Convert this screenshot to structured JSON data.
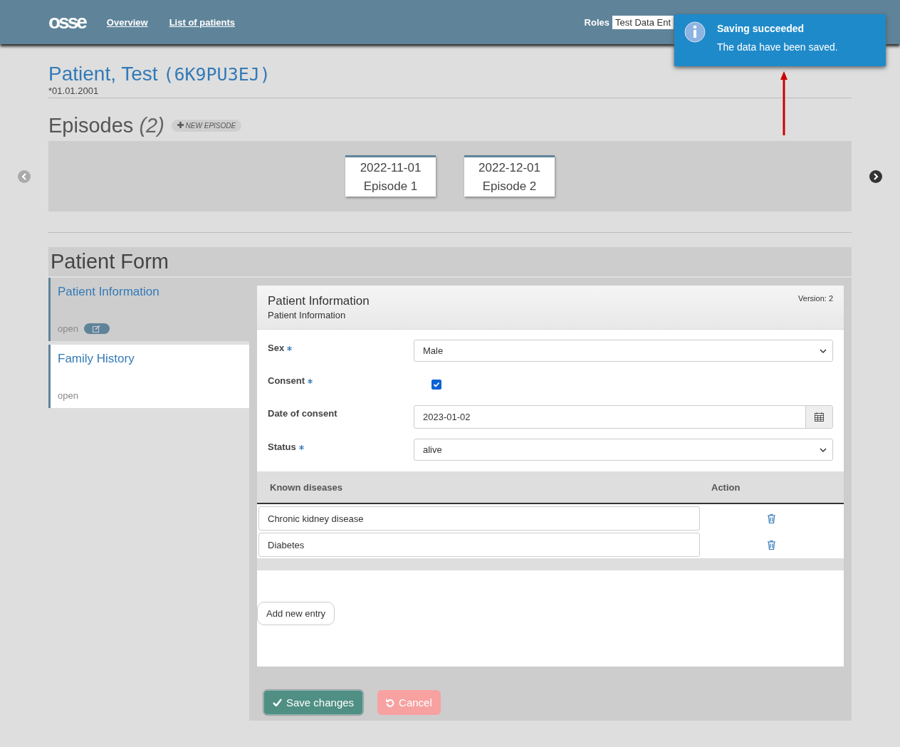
{
  "navbar": {
    "logo": "osse",
    "links": [
      "Overview",
      "List of patients"
    ],
    "roles_label": "Roles",
    "roles_value": "Test Data Ent"
  },
  "toast": {
    "title": "Saving succeeded",
    "message": "The data have been saved."
  },
  "patient": {
    "name": "Patient, Test",
    "id": "(6K9PU3EJ)",
    "birth": "*01.01.2001"
  },
  "episodes": {
    "title": "Episodes",
    "count": "(2)",
    "new_button": "NEW EPISODE",
    "items": [
      {
        "date": "2022-11-01",
        "label": "Episode 1"
      },
      {
        "date": "2022-12-01",
        "label": "Episode 2"
      }
    ]
  },
  "form": {
    "title": "Patient Form",
    "sections": [
      {
        "title": "Patient Information",
        "status": "open",
        "selected": true
      },
      {
        "title": "Family History",
        "status": "open",
        "selected": false
      }
    ],
    "panel": {
      "title": "Patient Information",
      "subtitle": "Patient Information",
      "version": "Version: 2",
      "fields": [
        {
          "kind": "select",
          "label": "Sex",
          "required": true,
          "value": "Male"
        },
        {
          "kind": "checkbox",
          "label": "Consent",
          "required": true,
          "checked": true
        },
        {
          "kind": "date",
          "label": "Date of consent",
          "required": false,
          "value": "2023-01-02"
        },
        {
          "kind": "select",
          "label": "Status",
          "required": true,
          "value": "alive"
        }
      ],
      "table": {
        "columns": [
          "Known diseases",
          "Action"
        ],
        "rows": [
          "Chronic kidney disease",
          "Diabetes"
        ]
      },
      "add_button": "Add new entry"
    },
    "save_button": "Save changes",
    "cancel_button": "Cancel"
  }
}
